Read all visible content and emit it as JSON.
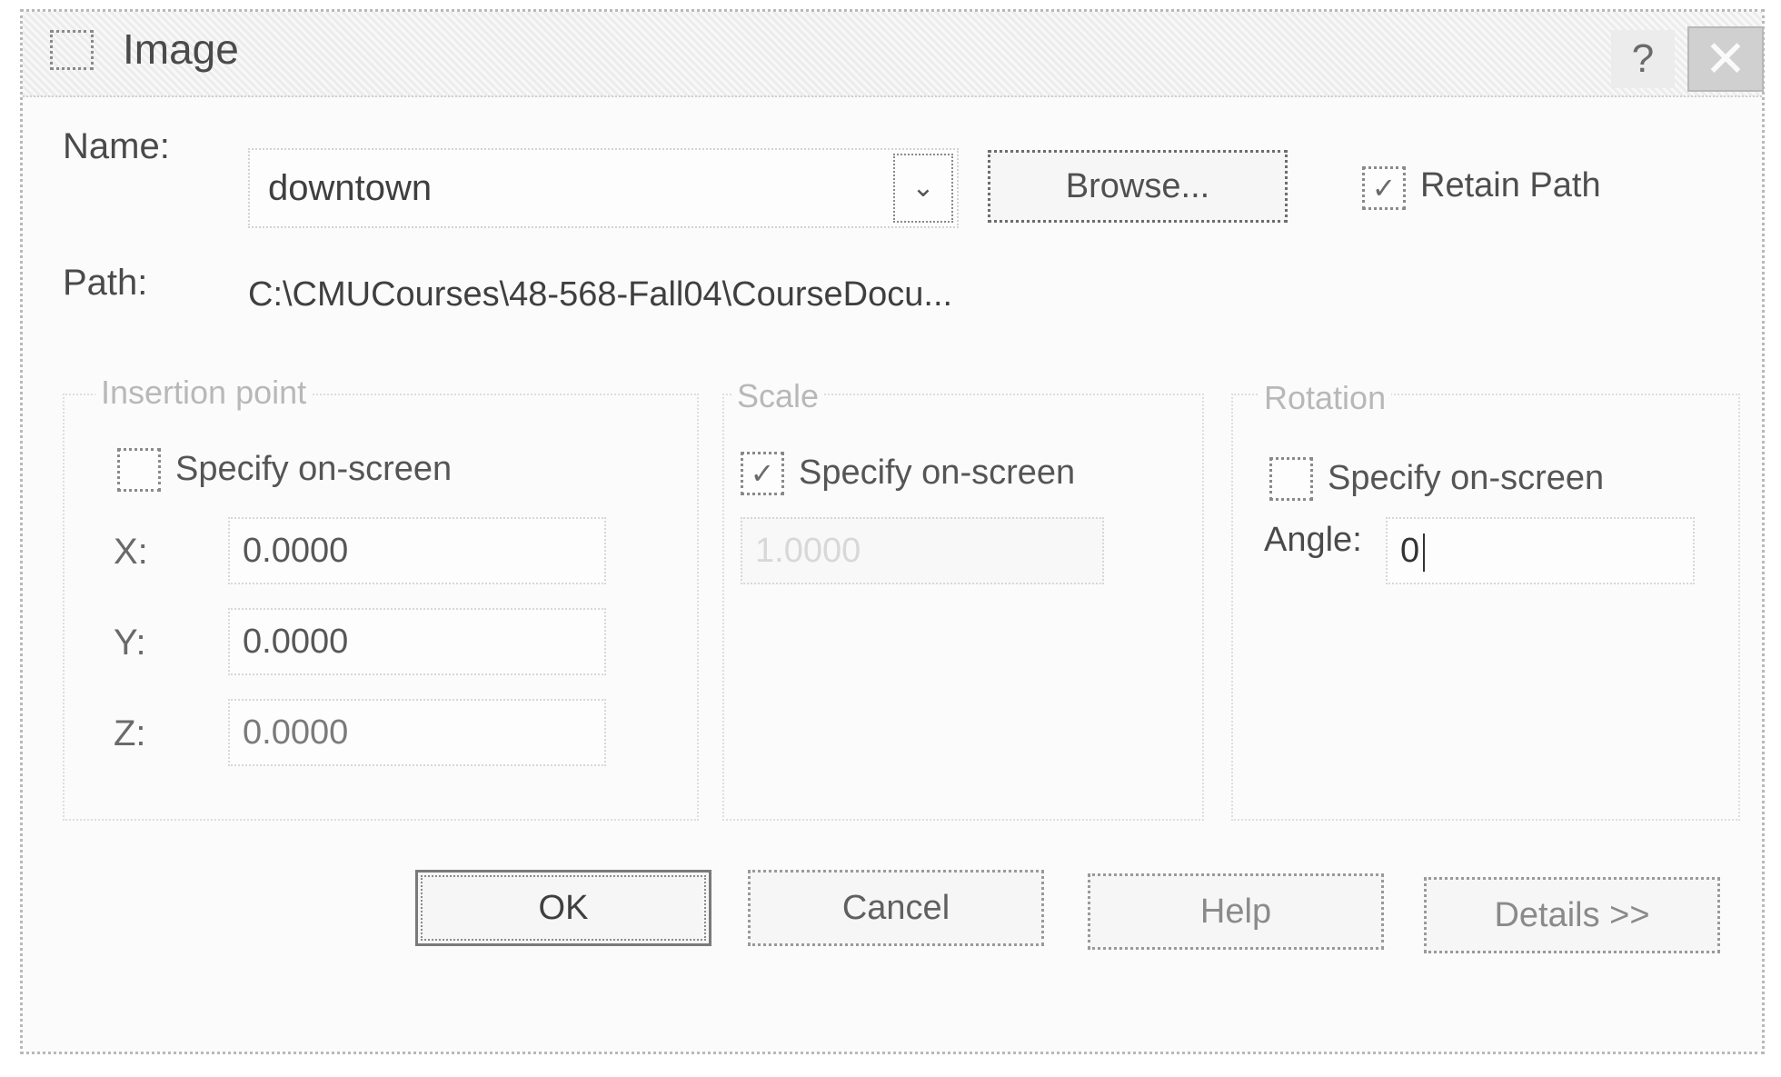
{
  "window": {
    "title": "Image",
    "help_glyph": "?",
    "close_glyph": "✕"
  },
  "name_row": {
    "label": "Name:",
    "value": "downtown",
    "browse_label": "Browse...",
    "retain_path_label": "Retain Path",
    "retain_path_checked": true
  },
  "path_row": {
    "label": "Path:",
    "value": "C:\\CMUCourses\\48-568-Fall04\\CourseDocu..."
  },
  "insertion_point": {
    "title": "Insertion point",
    "specify_label": "Specify on-screen",
    "specify_checked": false,
    "x_label": "X:",
    "x_value": "0.0000",
    "y_label": "Y:",
    "y_value": "0.0000",
    "z_label": "Z:",
    "z_value": "0.0000"
  },
  "scale": {
    "title": "Scale",
    "specify_label": "Specify on-screen",
    "specify_checked": true,
    "value": "1.0000"
  },
  "rotation": {
    "title": "Rotation",
    "specify_label": "Specify on-screen",
    "specify_checked": false,
    "angle_label": "Angle:",
    "angle_value": "0"
  },
  "buttons": {
    "ok": "OK",
    "cancel": "Cancel",
    "help": "Help",
    "details": "Details >>"
  },
  "icons": {
    "title": "image-icon",
    "check": "checkmark-icon",
    "dropdown": "chevron-down-icon"
  },
  "check_glyph": "✓",
  "dropdown_glyph": "⌄"
}
